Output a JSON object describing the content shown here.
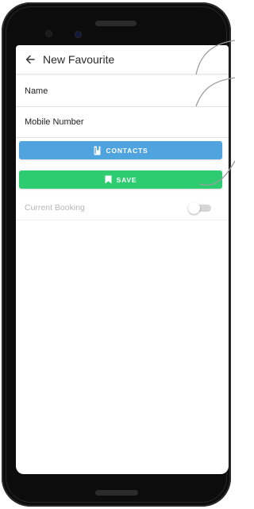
{
  "appbar": {
    "title": "New Favourite",
    "back_icon": "arrow-left-icon"
  },
  "form": {
    "name_label": "Name",
    "mobile_label": "Mobile Number"
  },
  "buttons": {
    "contacts_label": "CONTACTS",
    "contacts_icon": "contacts-book-icon",
    "contacts_color": "#4fa3de",
    "save_label": "SAVE",
    "save_icon": "bookmark-icon",
    "save_color": "#2ecc71"
  },
  "toggle": {
    "label": "Current Booking",
    "checked": false
  }
}
